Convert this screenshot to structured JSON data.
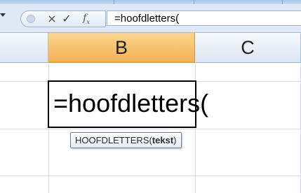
{
  "formula_bar": {
    "cancel_icon": "×",
    "enter_icon": "✓",
    "function_icon": "fx",
    "formula": "=hoofdletters("
  },
  "columns": [
    "B",
    "C"
  ],
  "active_cell": {
    "column": "B",
    "content": "=hoofdletters("
  },
  "function_tooltip": {
    "name": "HOOFDLETTERS(",
    "argument": "tekst",
    "close": ")"
  },
  "colors": {
    "selected_header": "#f3b256",
    "formula_bar_bg": "#dfe8f5",
    "grid_line": "#d6dde6"
  }
}
